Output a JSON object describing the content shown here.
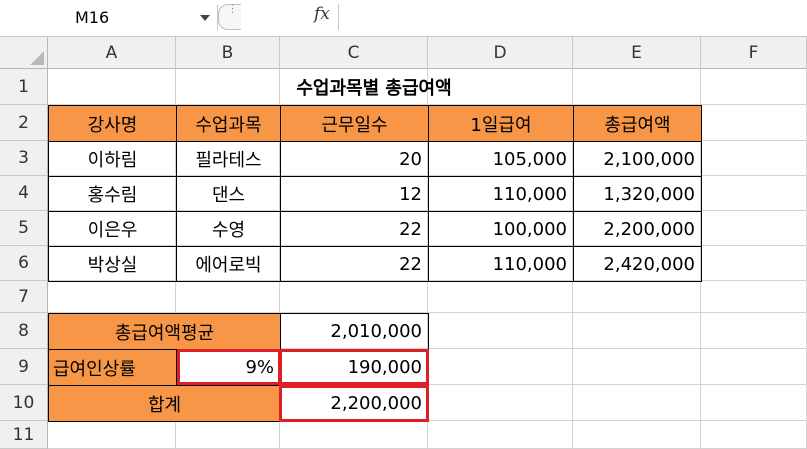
{
  "name_box": "M16",
  "formula_bar": {
    "fx_label": "fx",
    "content": ""
  },
  "columns": [
    "A",
    "B",
    "C",
    "D",
    "E",
    "F"
  ],
  "rows": [
    "1",
    "2",
    "3",
    "4",
    "5",
    "6",
    "7",
    "8",
    "9",
    "10",
    "11"
  ],
  "title": "수업과목별 총급여액",
  "headers": [
    "강사명",
    "수업과목",
    "근무일수",
    "1일급여",
    "총급여액"
  ],
  "records": [
    [
      "이하림",
      "필라테스",
      "20",
      "105,000",
      "2,100,000"
    ],
    [
      "홍수림",
      "댄스",
      "12",
      "110,000",
      "1,320,000"
    ],
    [
      "이은우",
      "수영",
      "22",
      "100,000",
      "2,200,000"
    ],
    [
      "박상실",
      "에어로빅",
      "22",
      "110,000",
      "2,420,000"
    ]
  ],
  "summary": {
    "avg_label": "총급여액평균",
    "avg_value": "2,010,000",
    "rate_label": "급여인상률",
    "rate_value": "9%",
    "rate_result": "190,000",
    "total_label": "합계",
    "total_value": "2,200,000"
  },
  "colors": {
    "header_fill": "#f79646",
    "highlight_border": "#e01e26"
  }
}
